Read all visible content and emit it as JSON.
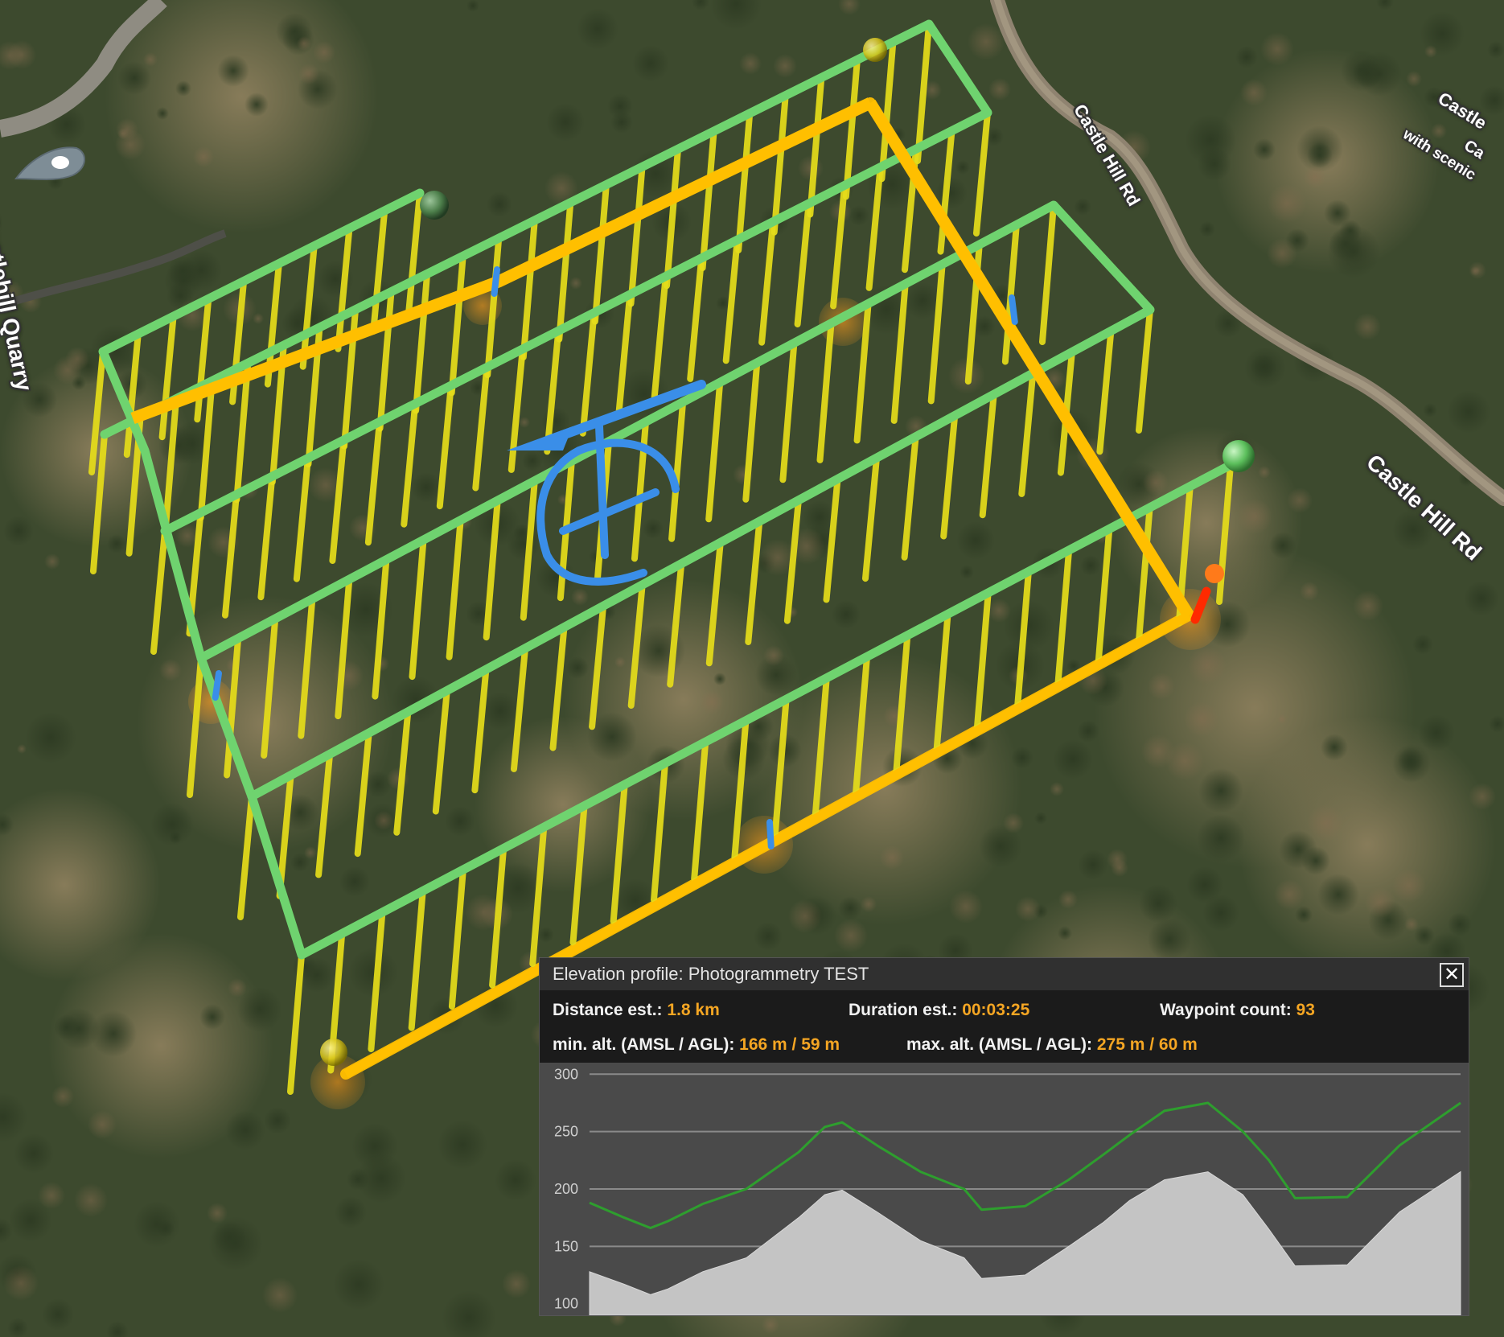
{
  "map": {
    "labels": {
      "quarry": "Castlehill Quarry",
      "road_a": "Castle Hill Rd",
      "road_b": "Castle Hill Rd",
      "corner_top": "Castle",
      "corner_mid": "Ca",
      "corner_bottom": "with scenic"
    },
    "colors": {
      "transect_green": "#6fd36f",
      "vertical_yellow": "#e6dd1a",
      "path_orange": "#ffbf00",
      "gizmo_blue": "#3a8ee8",
      "start_marker_red": "#ff2a00"
    },
    "icons": [
      "location-pin-icon",
      "move-gizmo-icon",
      "rotate-gizmo-icon",
      "close-icon"
    ]
  },
  "panel": {
    "title": "Elevation profile: Photogrammetry TEST",
    "close_label": "✕",
    "distance_label": "Distance est.:",
    "distance_value": "1.8 km",
    "duration_label": "Duration est.:",
    "duration_value": "00:03:25",
    "waypoints_label": "Waypoint count:",
    "waypoints_value": "93",
    "min_alt_label": "min. alt. (AMSL / AGL):",
    "min_alt_value": "166 m / 59 m",
    "max_alt_label": "max. alt. (AMSL / AGL):",
    "max_alt_value": "275 m / 60 m"
  },
  "chart_data": {
    "type": "area",
    "title": "",
    "xlabel": "",
    "ylabel": "",
    "ylim": [
      90,
      310
    ],
    "yticks": [
      300,
      250,
      200,
      150,
      100
    ],
    "grid": true,
    "x": [
      0,
      4,
      7,
      9,
      13,
      18,
      24,
      27,
      29,
      33,
      38,
      43,
      45,
      50,
      55,
      59,
      62,
      66,
      71,
      75,
      78,
      81,
      87,
      93,
      100
    ],
    "series": [
      {
        "kind": "line",
        "color": "#2e9e2e",
        "values": [
          188,
          175,
          166,
          172,
          187,
          200,
          232,
          254,
          258,
          238,
          215,
          200,
          182,
          185,
          208,
          230,
          247,
          268,
          275,
          250,
          225,
          192,
          193,
          238,
          275
        ]
      },
      {
        "kind": "area",
        "color": "#c4c4c4",
        "values": [
          128,
          117,
          108,
          113,
          128,
          140,
          175,
          195,
          199,
          180,
          155,
          140,
          122,
          125,
          150,
          171,
          190,
          208,
          215,
          195,
          165,
          133,
          134,
          180,
          215
        ]
      }
    ]
  }
}
